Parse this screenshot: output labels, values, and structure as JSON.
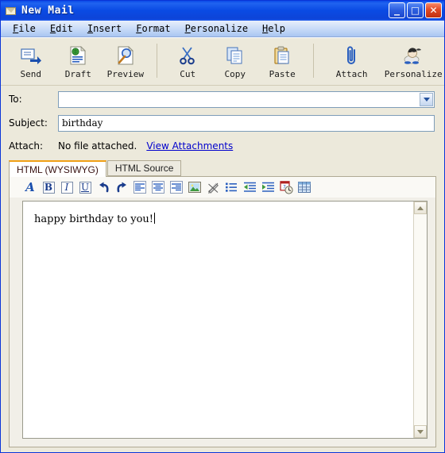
{
  "window": {
    "title": "New Mail",
    "icon": "envelope-icon",
    "buttons": {
      "minimize": "_",
      "maximize": "□",
      "close": "✕"
    },
    "border_color": "#0A35D8",
    "titlebar_color": "#0A4BE4"
  },
  "menubar": {
    "items": [
      {
        "label": "File",
        "accel": "F"
      },
      {
        "label": "Edit",
        "accel": "E"
      },
      {
        "label": "Insert",
        "accel": "I"
      },
      {
        "label": "Format",
        "accel": "F"
      },
      {
        "label": "Personalize",
        "accel": "P"
      },
      {
        "label": "Help",
        "accel": "H"
      }
    ]
  },
  "toolbar": {
    "buttons": [
      {
        "label": "Send",
        "icon": "send-icon"
      },
      {
        "label": "Draft",
        "icon": "draft-icon"
      },
      {
        "label": "Preview",
        "icon": "preview-icon"
      },
      {
        "label": "Cut",
        "icon": "scissors-icon"
      },
      {
        "label": "Copy",
        "icon": "copy-icon"
      },
      {
        "label": "Paste",
        "icon": "clipboard-icon"
      },
      {
        "label": "Attach",
        "icon": "paperclip-icon"
      },
      {
        "label": "Personalize",
        "icon": "personalize-icon"
      }
    ]
  },
  "fields": {
    "to": {
      "label": "To:",
      "value": "",
      "placeholder": "",
      "dropdown_icon": "chevron-down-icon"
    },
    "subject": {
      "label": "Subject:",
      "value": "birthday",
      "placeholder": ""
    },
    "attach": {
      "label": "Attach:",
      "status": "No file attached.",
      "link": "View Attachments",
      "link_color": "#0000CC"
    }
  },
  "editor": {
    "tabs": [
      {
        "label": "HTML (WYSIWYG)",
        "active": true
      },
      {
        "label": "HTML Source",
        "active": false
      }
    ],
    "active_tab_accent": "#F0A016",
    "format_toolbar": [
      {
        "name": "font-icon",
        "glyph": "A",
        "boxed": false
      },
      {
        "name": "bold-icon",
        "glyph": "B",
        "boxed": true
      },
      {
        "name": "italic-icon",
        "glyph": "I",
        "boxed": true
      },
      {
        "name": "underline-icon",
        "glyph": "U",
        "boxed": true
      },
      {
        "name": "undo-icon",
        "glyph": "↶",
        "boxed": false
      },
      {
        "name": "redo-icon",
        "glyph": "↷",
        "boxed": false
      },
      {
        "name": "align-left-icon",
        "glyph": "≡",
        "boxed": false
      },
      {
        "name": "align-center-icon",
        "glyph": "≡",
        "boxed": false
      },
      {
        "name": "align-right-icon",
        "glyph": "≡",
        "boxed": false
      },
      {
        "name": "insert-image-icon",
        "glyph": "▣",
        "boxed": false
      },
      {
        "name": "unlink-icon",
        "glyph": "✐",
        "boxed": false
      },
      {
        "name": "bullet-list-icon",
        "glyph": "•",
        "boxed": false
      },
      {
        "name": "indent-decrease-icon",
        "glyph": "⇤",
        "boxed": false
      },
      {
        "name": "indent-increase-icon",
        "glyph": "⇥",
        "boxed": false
      },
      {
        "name": "insert-datetime-icon",
        "glyph": "◴",
        "boxed": false
      },
      {
        "name": "insert-table-icon",
        "glyph": "⊞",
        "boxed": false
      }
    ],
    "body_text": "happy birthday to you!",
    "scrollbar": {
      "up_icon": "scroll-up-icon",
      "down_icon": "scroll-down-icon"
    }
  },
  "colors": {
    "client_background": "#ECE9DB",
    "panel_background": "#F1EFE8",
    "field_border": "#7E9DB9",
    "text": "#000000"
  }
}
